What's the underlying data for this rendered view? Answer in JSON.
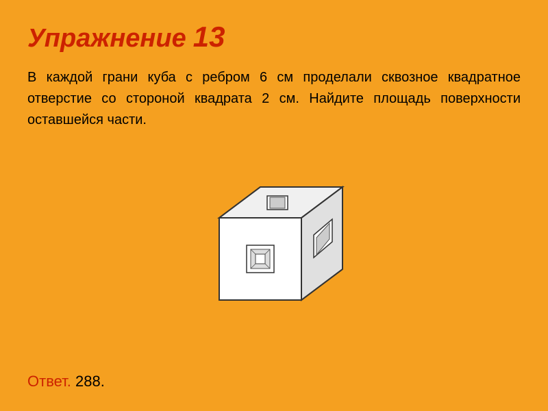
{
  "title": {
    "prefix": "Упражнение",
    "number": "13"
  },
  "problem": {
    "text": "В каждой грани куба с ребром 6 см проделали сквозное квадратное отверстие со стороной квадрата 2 см. Найдите площадь поверхности оставшейся части."
  },
  "answer": {
    "label": "Ответ.",
    "value": "288."
  },
  "colors": {
    "background": "#F5A020",
    "title": "#CC2200",
    "text": "#000000"
  }
}
